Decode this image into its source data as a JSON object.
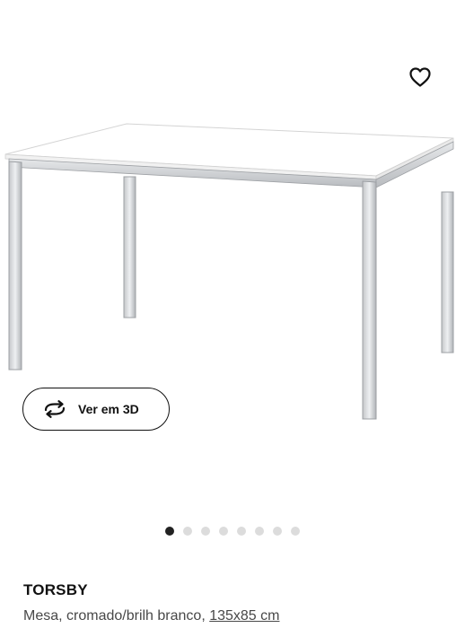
{
  "view_3d": {
    "label": "Ver em 3D",
    "icon": "rotate-arrows-icon"
  },
  "favorite": {
    "icon": "heart-outline-icon"
  },
  "carousel": {
    "total": 8,
    "active_index": 0
  },
  "product": {
    "name": "TORSBY",
    "description": "Mesa, cromado/brilh branco, ",
    "size": "135x85 cm",
    "image": "table-image"
  },
  "colors": {
    "text": "#111111",
    "secondary_text": "#484848",
    "dot_active": "#222222",
    "dot_inactive": "#dcdcdc"
  }
}
